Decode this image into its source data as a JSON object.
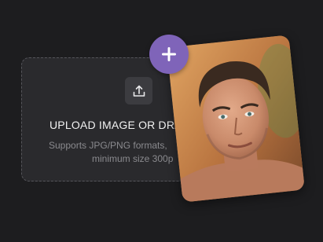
{
  "upload": {
    "title": "UPLOAD IMAGE OR DRA",
    "subtitle_line1": "Supports JPG/PNG formats,",
    "subtitle_line2": "minimum size 300p",
    "icon": "upload-icon"
  },
  "add_button": {
    "icon": "plus-icon",
    "color": "#7f64b9"
  },
  "photo": {
    "subject": "portrait of a man"
  },
  "colors": {
    "background": "#1d1d1f",
    "panel": "#2a2a2d",
    "accent": "#7f64b9"
  }
}
